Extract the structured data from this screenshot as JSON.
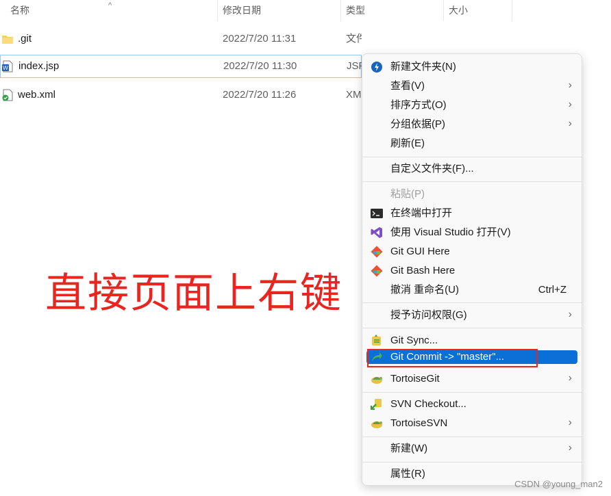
{
  "columns": {
    "name": "名称",
    "modified": "修改日期",
    "type": "类型",
    "size": "大小"
  },
  "files": [
    {
      "name": ".git",
      "modified": "2022/7/20 11:31",
      "type": "文件夹",
      "icon": "folder-icon"
    },
    {
      "name": "index.jsp",
      "modified": "2022/7/20 11:30",
      "type": "JSP",
      "icon": "jsp-file-icon"
    },
    {
      "name": "web.xml",
      "modified": "2022/7/20 11:26",
      "type": "XM",
      "icon": "xml-file-icon"
    }
  ],
  "annotation": "直接页面上右键",
  "menu": {
    "new_folder": "新建文件夹(N)",
    "view": "查看(V)",
    "sort": "排序方式(O)",
    "group": "分组依据(P)",
    "refresh": "刷新(E)",
    "customize": "自定义文件夹(F)...",
    "paste": "粘贴(P)",
    "terminal": "在终端中打开",
    "visual_studio": "使用 Visual Studio 打开(V)",
    "git_gui": "Git GUI Here",
    "git_bash": "Git Bash Here",
    "undo_rename": "撤消 重命名(U)",
    "undo_shortcut": "Ctrl+Z",
    "grant_access": "授予访问权限(G)",
    "git_sync": "Git Sync...",
    "git_commit": "Git Commit -> \"master\"...",
    "tortoisegit": "TortoiseGit",
    "svn_checkout": "SVN Checkout...",
    "tortoisesvn": "TortoiseSVN",
    "new": "新建(W)",
    "properties": "属性(R)"
  },
  "colors": {
    "highlight": "#0a6fd6",
    "annotation": "#e8261f"
  },
  "watermark": "CSDN @young_man2"
}
